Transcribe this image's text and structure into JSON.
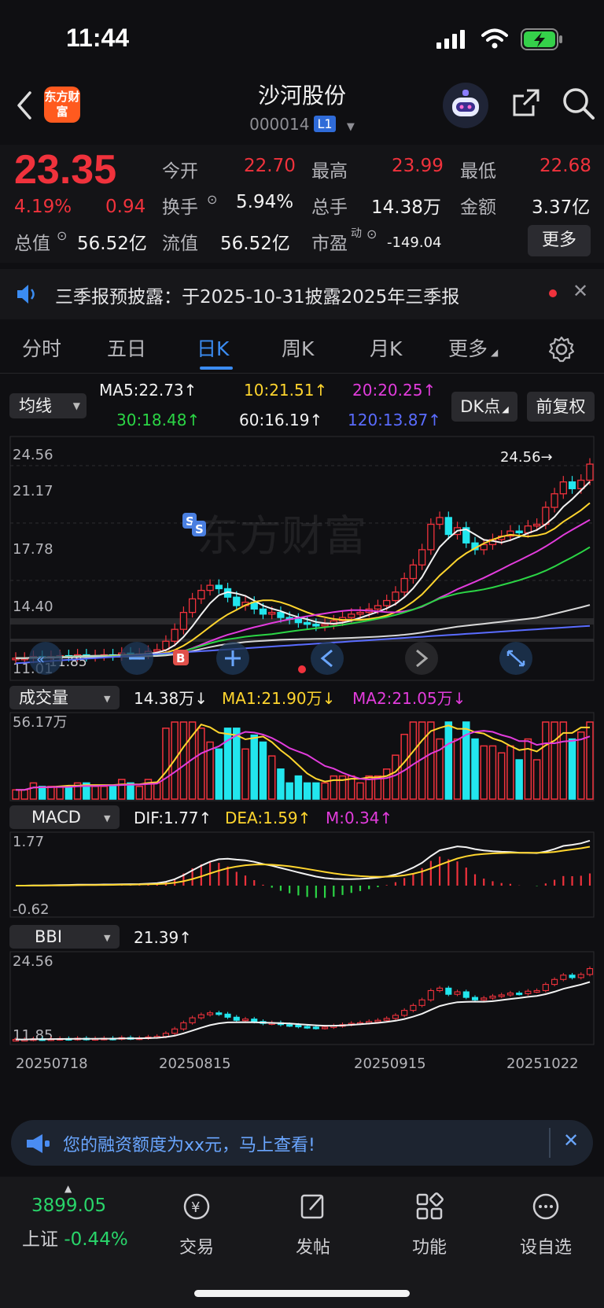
{
  "status": {
    "time": "11:44"
  },
  "header": {
    "logo_text": "东方财富",
    "title": "沙河股份",
    "code": "000014",
    "badge": "L1"
  },
  "quote": {
    "price": "23.35",
    "change_pct": "4.19%",
    "change_amt": "0.94",
    "open_label": "今开",
    "open": "22.70",
    "high_label": "最高",
    "high": "23.99",
    "low_label": "最低",
    "low": "22.68",
    "turnover_label": "换手",
    "turnover": "5.94%",
    "volume_label": "总手",
    "volume": "14.38万",
    "amount_label": "金额",
    "amount": "3.37亿",
    "mktcap_label": "总值",
    "mktcap": "56.52亿",
    "float_label": "流值",
    "float": "56.52亿",
    "pe_label": "市盈",
    "pe_sup": "动",
    "pe": "-149.04",
    "more_label": "更多"
  },
  "notice": {
    "text": "三季报预披露：于2025-10-31披露2025年三季报"
  },
  "tabs": [
    {
      "label": "分时"
    },
    {
      "label": "五日"
    },
    {
      "label": "日K"
    },
    {
      "label": "周K"
    },
    {
      "label": "月K"
    },
    {
      "label": "更多"
    }
  ],
  "ma_bar": {
    "selector": "均线",
    "ma5": "MA5:22.73↑",
    "ma10": "10:21.51↑",
    "ma20": "20:20.25↑",
    "ma30": "30:18.48↑",
    "ma60": "60:16.19↑",
    "ma120": "120:13.87↑",
    "dk_button": "DK点",
    "adjust_button": "前复权"
  },
  "price_axis": {
    "p1": "24.56",
    "p2": "21.17",
    "p3": "17.78",
    "p4": "14.40",
    "p5": "11.01",
    "high_mark": "24.56→",
    "low_mark": "11.85",
    "watermark": "东方财富"
  },
  "volume_bar": {
    "selector": "成交量",
    "vol": "14.38万↓",
    "ma1": "MA1:21.90万↓",
    "ma2": "MA2:21.05万↓",
    "axis_top": "56.17万"
  },
  "macd_bar": {
    "selector": "MACD",
    "dif": "DIF:1.77↑",
    "dea": "DEA:1.59↑",
    "m": "M:0.34↑",
    "axis_top": "1.77",
    "axis_bottom": "-0.62"
  },
  "bbi_bar": {
    "selector": "BBI",
    "value": "21.39↑",
    "axis_top": "24.56",
    "axis_bottom": "11.85"
  },
  "dates": [
    "20250718",
    "20250815",
    "20250915",
    "20251022"
  ],
  "promo": {
    "text": "您的融资额度为xx元，马上查看!"
  },
  "bottom_tabs": {
    "index_value": "3899.05",
    "index_name": "上证",
    "index_change": "-0.44%",
    "items": [
      {
        "label": "交易",
        "icon": "yen-icon"
      },
      {
        "label": "发帖",
        "icon": "edit-icon"
      },
      {
        "label": "功能",
        "icon": "grid-icon"
      },
      {
        "label": "设自选",
        "icon": "more-icon"
      }
    ]
  },
  "colors": {
    "up": "#f0323c",
    "down": "#22e6ee",
    "accent": "#3b8cf2"
  }
}
